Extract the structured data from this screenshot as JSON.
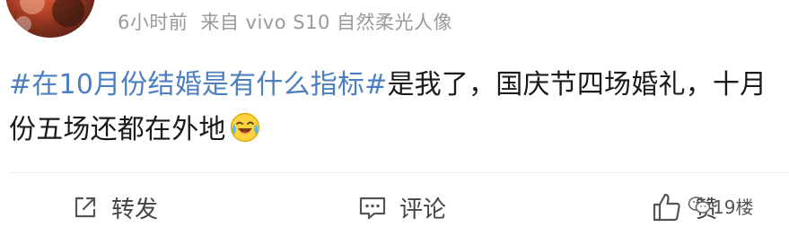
{
  "post": {
    "time": "6小时前",
    "source": "来自 vivo S10 自然柔光人像",
    "content": {
      "topic": "#在10月份结婚是有什么指标#",
      "text": "是我了，国庆节四场婚礼，十月份五场还都在外地",
      "emoji": "laughing-crying-emoji"
    }
  },
  "actions": {
    "repost_label": "转发",
    "comment_label": "评论",
    "like_label": "赞"
  },
  "watermark": {
    "text": "19楼"
  },
  "colors": {
    "topic": "#4b7fc0",
    "meta": "#9a9a9a",
    "text": "#1a1a1a",
    "action": "#444444"
  }
}
